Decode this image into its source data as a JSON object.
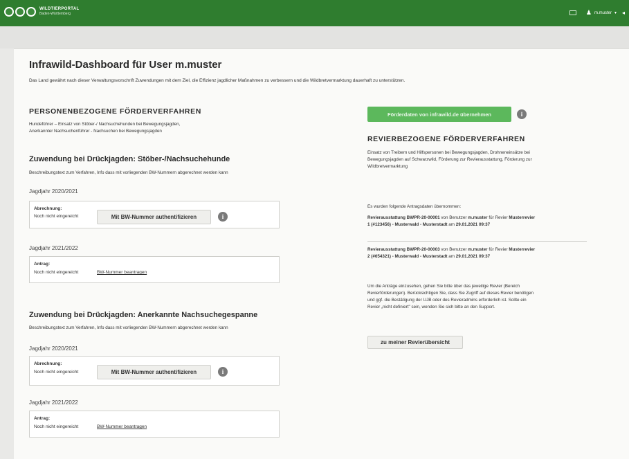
{
  "header": {
    "brand_title": "WILDTIERPORTAL",
    "brand_subtitle": "Baden-Württemberg",
    "user_name": "m.muster",
    "icons": [
      "logo-circles",
      "mail-icon",
      "user-icon",
      "chevron-down-icon",
      "arrow-icon"
    ],
    "color": "#2f7d2f"
  },
  "page": {
    "title": "Infrawild-Dashboard für User m.muster",
    "intro": "Das Land gewährt nach dieser Verwaltungsvorschrift Zuwendungen mit dem Ziel, die Effizienz jagdlicher Maßnahmen zu verbessern und die Wildbretvermarktung dauerhaft zu unterstützen."
  },
  "personal": {
    "title": "PERSONENBEZOGENE FÖRDERVERFAHREN",
    "desc_line1": "Hundeführer – Einsatz von Stöber-/ Nachsuchehunden bei Bewegungsjagden,",
    "desc_line2": "Anerkannter Nachsuchenführer - Nachsuchen bei Bewegungsjagden",
    "sections": [
      {
        "title": "Zuwendung bei Drückjagden: Stöber-/Nachsuchehunde",
        "desc": "Beschreibungstext zum Verfahren, Info dass mit vorliegenden BW-Nummern abgerechnet werden kann",
        "year1": "Jagdjahr 2020/2021",
        "box1_label": "Abrechnung:",
        "box1_status": "Noch nicht eingereicht",
        "box1_button": "Mit BW-Nummer authentifizieren",
        "year2": "Jagdjahr 2021/2022",
        "box2_label": "Antrag:",
        "box2_status": "Noch nicht eingereicht",
        "box2_link": "BW-Nummer beantragen"
      },
      {
        "title": "Zuwendung bei Drückjagden: Anerkannte Nachsuchegespanne",
        "desc": "Beschreibungstext zum Verfahren, Info dass mit vorliegenden BW-Nummern abgerechnet werden kann",
        "year1": "Jagdjahr 2020/2021",
        "box1_label": "Abrechnung:",
        "box1_status": "Noch nicht eingereicht",
        "box1_button": "Mit BW-Nummer authentifizieren",
        "year2": "Jagdjahr 2021/2022",
        "box2_label": "Antrag:",
        "box2_status": "Noch nicht eingereicht",
        "box2_link": "BW-Nummer beantragen"
      }
    ]
  },
  "revier": {
    "import_button": "Förderdaten von infrawild.de übernehmen",
    "import_button_color": "#5cb85c",
    "title": "REVIERBEZOGENE FÖRDERVERFAHREN",
    "desc_line1": "Einsatz von Treibern und Hilfspersonen bei Bewegungsjagden, Drohneneinsätze bei",
    "desc_line2": "Bewegungsjagden auf Schwarzwild, Förderung zur Revierausstattung, Förderung zur",
    "desc_line3": "Wildbretvermarktung",
    "import_note": "Es wurden folgende Antragsdaten übernommen:",
    "entries": [
      {
        "id": "Revierausstattung BWPR-20-00001",
        "by": " von Benutzer ",
        "user": "m.muster",
        "for": " für Revier ",
        "revier_l1": "Musterrevier",
        "revier_l2": "1 (#123456) - Musterwald - Musterstadt",
        "on": " am ",
        "date": "29.01.2021 09:37"
      },
      {
        "id": "Revierausstattung BWPR-20-00003",
        "by": " von Benutzer ",
        "user": "m.muster",
        "for": " für Revier ",
        "revier_l1": "Musterrevier",
        "revier_l2": "2 (#654321) - Musterwald - Musterstadt",
        "on": " am ",
        "date": "29.01.2021 09:37"
      }
    ],
    "hint_line1": "Um die Anträge einzusehen, gehen Sie bitte über das jeweilige Revier (Bereich",
    "hint_line2": "Revierförderungen). Berücksichtigen Sie, dass Sie Zugriff auf dieses Revier benötigen",
    "hint_line3": "und ggf. die Bestätigung der UJB oder des Revieradmins erforderlich ist. Sollte ein",
    "hint_line4": "Revier „nicht definiert\" sein, wenden Sie sich bitte an den Support.",
    "overview_button": "zu meiner Revierübersicht"
  }
}
